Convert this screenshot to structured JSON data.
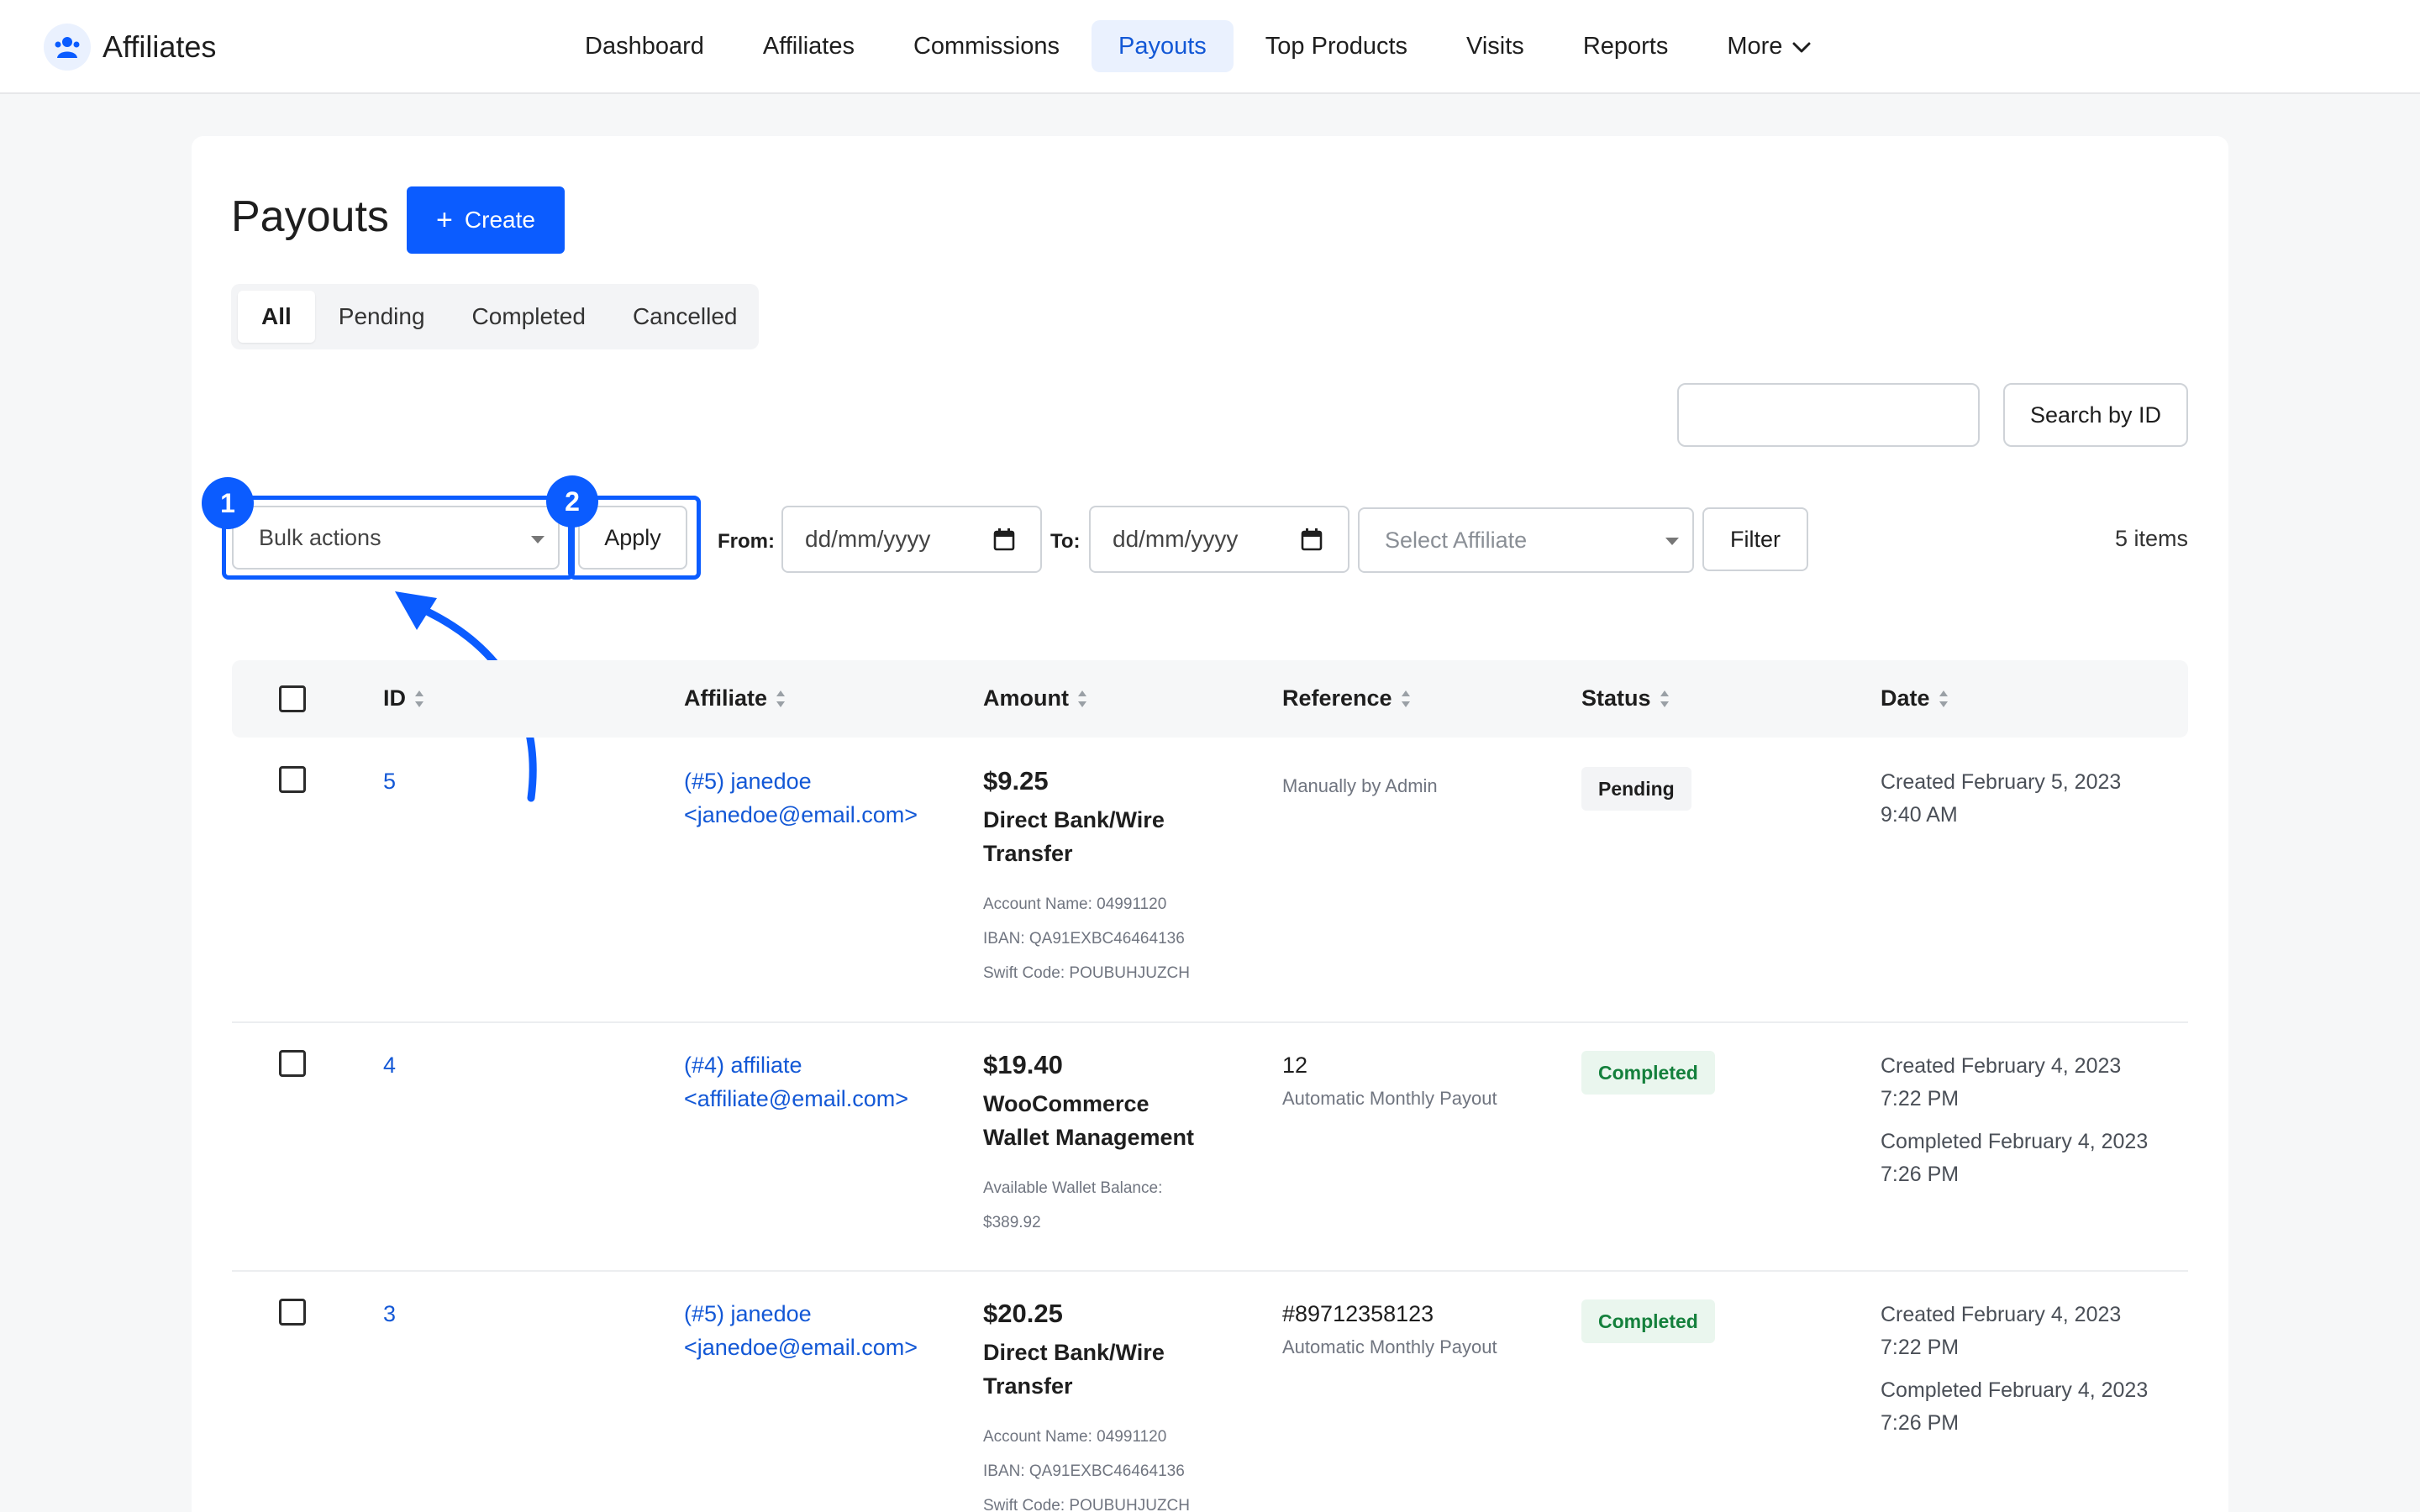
{
  "brand": {
    "name": "Affiliates",
    "logo_icon": "affiliates-logo-icon"
  },
  "nav": {
    "items": [
      {
        "label": "Dashboard"
      },
      {
        "label": "Affiliates"
      },
      {
        "label": "Commissions"
      },
      {
        "label": "Payouts",
        "active": true
      },
      {
        "label": "Top Products"
      },
      {
        "label": "Visits"
      },
      {
        "label": "Reports"
      },
      {
        "label": "More"
      }
    ]
  },
  "page": {
    "title": "Payouts",
    "create_label": "Create"
  },
  "tabs": [
    {
      "label": "All",
      "active": true
    },
    {
      "label": "Pending"
    },
    {
      "label": "Completed"
    },
    {
      "label": "Cancelled"
    }
  ],
  "search": {
    "value": "",
    "button_label": "Search by ID"
  },
  "filters": {
    "bulk_actions": "Bulk actions",
    "apply_label": "Apply",
    "from_label": "From:",
    "to_label": "To:",
    "date_placeholder": "dd/mm/yyyy",
    "affiliate_placeholder": "Select Affiliate",
    "filter_label": "Filter",
    "items_count": "5 items"
  },
  "annotations": {
    "badge_1": "1",
    "badge_2": "2"
  },
  "table": {
    "headers": {
      "id": "ID",
      "affiliate": "Affiliate",
      "amount": "Amount",
      "reference": "Reference",
      "status": "Status",
      "date": "Date"
    },
    "rows": [
      {
        "id": "5",
        "affiliate_line1": "(#5) janedoe",
        "affiliate_line2": "<janedoe@email.com>",
        "amount": "$9.25",
        "method_line1": "Direct Bank/Wire",
        "method_line2": "Transfer",
        "details": [
          "Account Name: 04991120",
          "IBAN: QA91EXBC46464136",
          "Swift Code: POUBUHJUZCH"
        ],
        "reference_main": "",
        "reference_sub": "Manually by Admin",
        "status": "Pending",
        "created_line1": "Created February 5, 2023",
        "created_line2": "9:40 AM",
        "completed_line1": "",
        "completed_line2": ""
      },
      {
        "id": "4",
        "affiliate_line1": "(#4) affiliate",
        "affiliate_line2": "<affiliate@email.com>",
        "amount": "$19.40",
        "method_line1": "WooCommerce",
        "method_line2": "Wallet Management",
        "details": [
          "Available Wallet Balance:",
          "$389.92"
        ],
        "reference_main": "12",
        "reference_sub": "Automatic Monthly Payout",
        "status": "Completed",
        "created_line1": "Created February 4, 2023",
        "created_line2": "7:22 PM",
        "completed_line1": "Completed February 4, 2023",
        "completed_line2": "7:26 PM"
      },
      {
        "id": "3",
        "affiliate_line1": "(#5) janedoe",
        "affiliate_line2": "<janedoe@email.com>",
        "amount": "$20.25",
        "method_line1": "Direct Bank/Wire",
        "method_line2": "Transfer",
        "details": [
          "Account Name: 04991120",
          "IBAN: QA91EXBC46464136",
          "Swift Code: POUBUHJUZCH"
        ],
        "reference_main": "#89712358123",
        "reference_sub": "Automatic Monthly Payout",
        "status": "Completed",
        "created_line1": "Created February 4, 2023",
        "created_line2": "7:22 PM",
        "completed_line1": "Completed February 4, 2023",
        "completed_line2": "7:26 PM"
      }
    ]
  },
  "colors": {
    "accent": "#0b5cff",
    "link": "#1358d6",
    "completed_bg": "#eaf6ee",
    "completed_text": "#14803c",
    "pending_bg": "#f3f4f6"
  }
}
